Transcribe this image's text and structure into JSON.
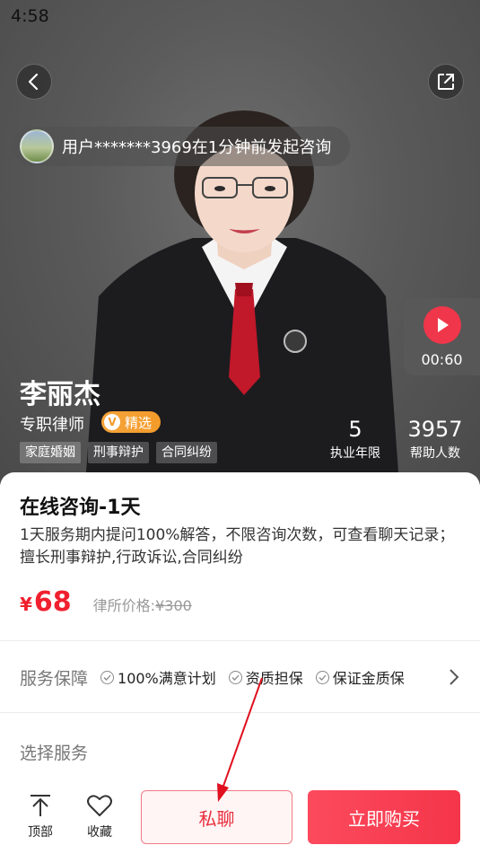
{
  "status_bar": {
    "time": "4:58"
  },
  "notice": {
    "text": "用户*******3969在1分钟前发起咨询"
  },
  "video": {
    "duration": "00:60"
  },
  "lawyer": {
    "name": "李丽杰",
    "title": "专职律师",
    "badge": "精选",
    "badge_icon_letter": "V",
    "tags": [
      "家庭婚姻",
      "刑事辩护",
      "合同纠纷"
    ],
    "stats": [
      {
        "value": "5",
        "label": "执业年限"
      },
      {
        "value": "3957",
        "label": "帮助人数"
      }
    ]
  },
  "service": {
    "title": "在线咨询-1天",
    "description": "1天服务期内提问100%解答，不限咨询次数，可查看聊天记录；擅长刑事辩护,行政诉讼,合同纠纷",
    "currency": "¥",
    "price": "68",
    "original_label": "律所价格:",
    "original_price": "¥300"
  },
  "guarantee": {
    "title": "服务保障",
    "items": [
      "100%满意计划",
      "资质担保",
      "保证金质保"
    ]
  },
  "choose_service": {
    "label": "选择服务"
  },
  "bottom_bar": {
    "top_label": "顶部",
    "favorite_label": "收藏",
    "chat_label": "私聊",
    "buy_label": "立即购买"
  },
  "colors": {
    "accent_red": "#f0202f",
    "buy_button": "#f5354a",
    "badge_orange": "#f39b2a",
    "annotation_red": "#e0101e"
  },
  "icons": [
    "back-icon",
    "share-icon",
    "play-icon",
    "check-circle-icon",
    "chevron-right-icon",
    "to-top-icon",
    "heart-icon"
  ]
}
